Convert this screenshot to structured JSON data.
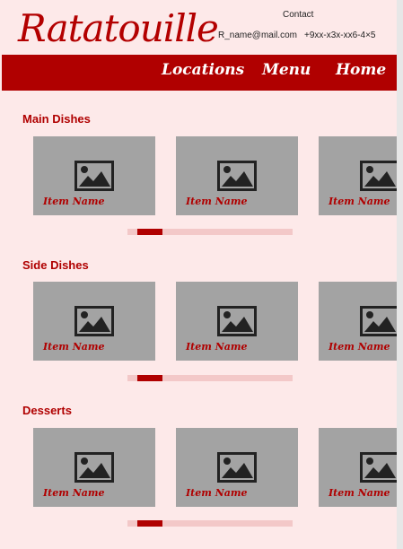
{
  "brand": {
    "logo_text": "Ratatouille",
    "accent_color": "#b00000",
    "background_color": "#fde9e9"
  },
  "contact": {
    "title": "Contact",
    "email": "R_name@mail.com",
    "phone": "+9xx-x3x-xx6-4×5"
  },
  "nav": {
    "locations": "Locations",
    "menu": "Menu",
    "home": "Home"
  },
  "sections": [
    {
      "title": "Main Dishes",
      "items": [
        {
          "name": "Item Name",
          "icon": "image-placeholder-icon"
        },
        {
          "name": "Item Name",
          "icon": "image-placeholder-icon"
        },
        {
          "name": "Item Name",
          "icon": "image-placeholder-icon"
        }
      ]
    },
    {
      "title": "Side Dishes",
      "items": [
        {
          "name": "Item Name",
          "icon": "image-placeholder-icon"
        },
        {
          "name": "Item Name",
          "icon": "image-placeholder-icon"
        },
        {
          "name": "Item Name",
          "icon": "image-placeholder-icon"
        }
      ]
    },
    {
      "title": "Desserts",
      "items": [
        {
          "name": "Item Name",
          "icon": "image-placeholder-icon"
        },
        {
          "name": "Item Name",
          "icon": "image-placeholder-icon"
        },
        {
          "name": "Item Name",
          "icon": "image-placeholder-icon"
        }
      ]
    }
  ]
}
